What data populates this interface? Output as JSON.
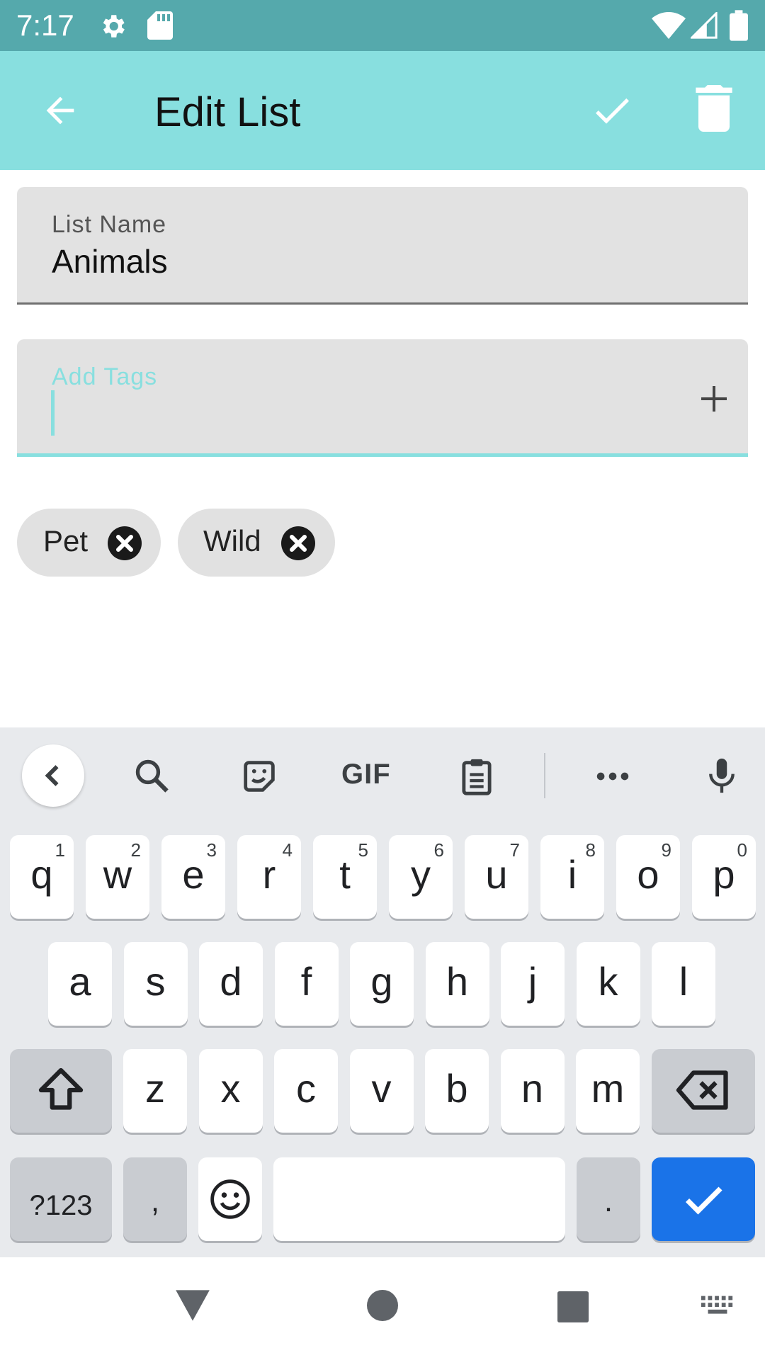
{
  "status_bar": {
    "time": "7:17",
    "icons": [
      "settings-icon",
      "sd-card-icon",
      "wifi-icon",
      "cell-signal-icon",
      "battery-icon"
    ]
  },
  "app_bar": {
    "title": "Edit List",
    "actions": [
      "back-arrow-icon",
      "check-icon",
      "delete-icon"
    ],
    "color": "#88dfdf"
  },
  "form": {
    "list_name": {
      "label": "List Name",
      "value": "Animals"
    },
    "tags": {
      "label": "Add Tags",
      "value": ""
    }
  },
  "chips": [
    {
      "label": "Pet"
    },
    {
      "label": "Wild"
    }
  ],
  "keyboard": {
    "toolbar": [
      "collapse-icon",
      "search-icon",
      "sticker-icon",
      "gif-icon",
      "clipboard-icon",
      "more-icon",
      "microphone-icon"
    ],
    "gif_label": "GIF",
    "row1": [
      {
        "char": "q",
        "hint": "1"
      },
      {
        "char": "w",
        "hint": "2"
      },
      {
        "char": "e",
        "hint": "3"
      },
      {
        "char": "r",
        "hint": "4"
      },
      {
        "char": "t",
        "hint": "5"
      },
      {
        "char": "y",
        "hint": "6"
      },
      {
        "char": "u",
        "hint": "7"
      },
      {
        "char": "i",
        "hint": "8"
      },
      {
        "char": "o",
        "hint": "9"
      },
      {
        "char": "p",
        "hint": "0"
      }
    ],
    "row2": [
      "a",
      "s",
      "d",
      "f",
      "g",
      "h",
      "j",
      "k",
      "l"
    ],
    "row3": [
      "z",
      "x",
      "c",
      "v",
      "b",
      "n",
      "m"
    ],
    "row4": {
      "symbols": "?123",
      "comma": ",",
      "period": "."
    },
    "action_color": "#1a73e8"
  },
  "nav_bar": {
    "buttons": [
      "back-triangle-icon",
      "home-circle-icon",
      "recents-square-icon",
      "keyboard-switch-icon"
    ]
  }
}
